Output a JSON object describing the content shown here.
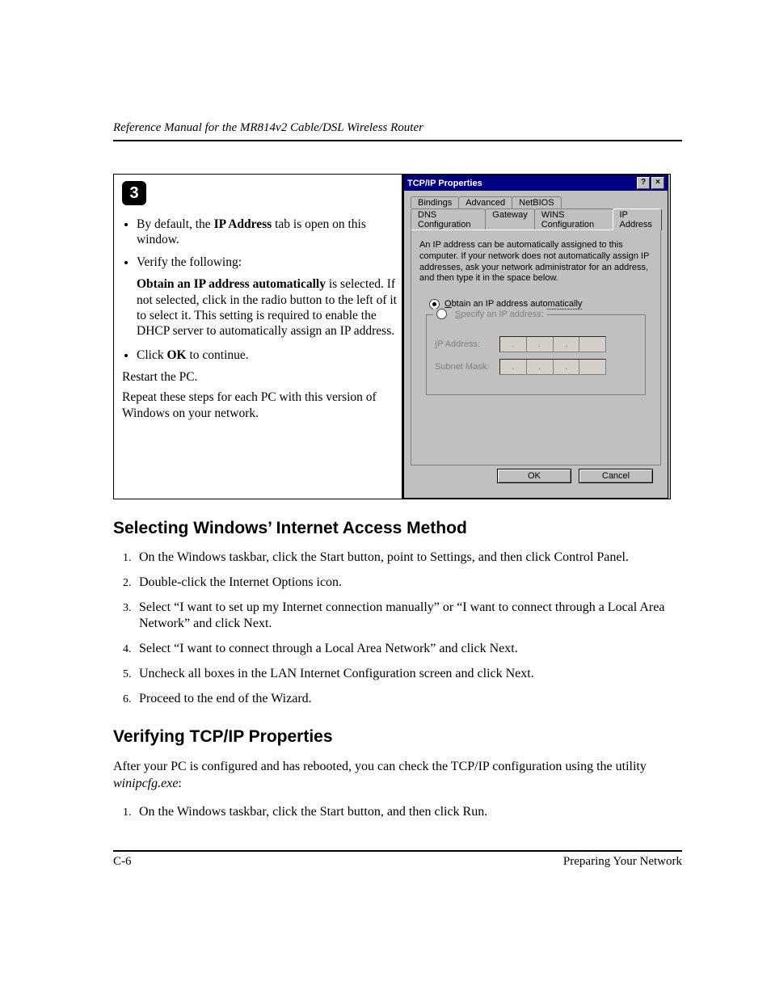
{
  "header": {
    "title": "Reference Manual for the MR814v2 Cable/DSL Wireless Router"
  },
  "step": {
    "number": "3",
    "bullets": {
      "b1_pre": "By default, the ",
      "b1_bold": "IP Address",
      "b1_post": " tab is open on this window.",
      "b2": "Verify the following:",
      "detail_bold": "Obtain an IP address automatically",
      "detail_rest": " is selected. If not selected, click in the radio button to the left of it to select it.  This setting is required to enable the DHCP server to automatically assign an IP address.",
      "b3_pre": "Click ",
      "b3_bold": "OK",
      "b3_post": " to continue."
    },
    "after1": "Restart the PC.",
    "after2": "Repeat these steps for each PC with this version of Windows on your network."
  },
  "dialog": {
    "title": "TCP/IP Properties",
    "help_btn": "?",
    "close_btn": "×",
    "tabs_row1": [
      "Bindings",
      "Advanced",
      "NetBIOS"
    ],
    "tabs_row2": [
      "DNS Configuration",
      "Gateway",
      "WINS Configuration",
      "IP Address"
    ],
    "desc": "An IP address can be automatically assigned to this computer. If your network does not automatically assign IP addresses, ask your network administrator for an address, and then type it in the space below.",
    "radio_auto": "Obtain an IP address automatically",
    "radio_specify": "Specify an IP address:",
    "field_ip": "IP Address:",
    "field_mask": "Subnet Mask:",
    "ok": "OK",
    "cancel": "Cancel"
  },
  "section1": {
    "heading": "Selecting Windows’ Internet Access Method",
    "items": [
      "On the Windows taskbar, click the Start button, point to Settings, and then click Control Panel.",
      "Double-click the Internet Options icon.",
      "Select “I want to set up my Internet connection manually” or “I want to connect through a Local Area Network” and click Next.",
      "Select “I want to connect through a Local Area Network” and click Next.",
      "Uncheck all boxes in the LAN Internet Configuration screen and click Next.",
      "Proceed to the end of the Wizard."
    ]
  },
  "section2": {
    "heading": "Verifying TCP/IP Properties",
    "intro_pre": "After your PC is configured and has rebooted, you can check the TCP/IP configuration using the utility ",
    "intro_em": "winipcfg.exe",
    "intro_post": ":",
    "items": [
      "On the Windows taskbar, click the Start button, and then click Run."
    ]
  },
  "footer": {
    "page": "C-6",
    "label": "Preparing Your Network"
  }
}
